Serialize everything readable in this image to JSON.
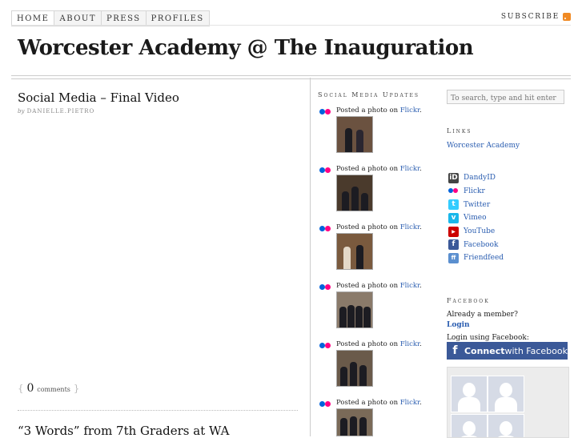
{
  "nav": {
    "items": [
      "HOME",
      "ABOUT",
      "PRESS",
      "PROFILES"
    ],
    "subscribe": "SUBSCRIBE"
  },
  "site": {
    "title": "Worcester Academy @ The Inauguration"
  },
  "posts": [
    {
      "title": "Social Media – Final Video",
      "by": "by",
      "author": "DANIELLE.PIETRO",
      "comments_open": "{",
      "comments_count": "0",
      "comments_label": "comments",
      "comments_close": "}"
    },
    {
      "title": "“3 Words” from 7th Graders at WA"
    }
  ],
  "social_updates": {
    "heading": "Social Media Updates",
    "items": [
      {
        "text": "Posted a photo on ",
        "link": "Flickr",
        "end": "."
      },
      {
        "text": "Posted a photo on ",
        "link": "Flickr",
        "end": "."
      },
      {
        "text": "Posted a photo on ",
        "link": "Flickr",
        "end": "."
      },
      {
        "text": "Posted a photo on ",
        "link": "Flickr",
        "end": "."
      },
      {
        "text": "Posted a photo on ",
        "link": "Flickr",
        "end": "."
      },
      {
        "text": "Posted a photo on ",
        "link": "Flickr",
        "end": "."
      }
    ]
  },
  "sidebar": {
    "search_placeholder": "To search, type and hit enter",
    "links_heading": "Links",
    "links": [
      "Worcester Academy"
    ],
    "social": [
      {
        "label": "DandyID",
        "icon": "dandyid-icon",
        "color": "#444444"
      },
      {
        "label": "Flickr",
        "icon": "flickr-icon",
        "color": "#ffffff"
      },
      {
        "label": "Twitter",
        "icon": "twitter-icon",
        "color": "#33ccff"
      },
      {
        "label": "Vimeo",
        "icon": "vimeo-icon",
        "color": "#1ab7ea"
      },
      {
        "label": "YouTube",
        "icon": "youtube-icon",
        "color": "#cc0000"
      },
      {
        "label": "Facebook",
        "icon": "facebook-icon",
        "color": "#3b5998"
      },
      {
        "label": "Friendfeed",
        "icon": "friendfeed-icon",
        "color": "#5b8fcf"
      }
    ],
    "facebook_heading": "Facebook",
    "already_member": "Already a member?",
    "login": "Login",
    "login_using": "Login using Facebook:",
    "connect_bold": "Connect",
    "connect_rest": " with Facebook"
  },
  "colors": {
    "link": "#2a5db0",
    "facebook": "#3b5998",
    "rss": "#f08a24",
    "flickr_blue": "#0063dc",
    "flickr_pink": "#ff0084"
  }
}
